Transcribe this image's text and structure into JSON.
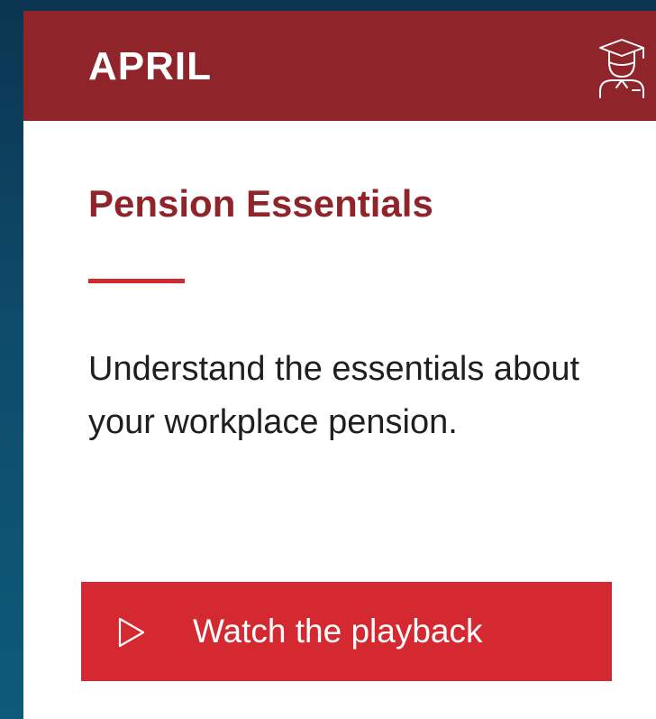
{
  "card": {
    "month": "APRIL",
    "header_icon": "graduation-student-icon",
    "title": "Pension Essentials",
    "description": "Understand the essentials about your workplace pension.",
    "action": {
      "label": "Watch the playback",
      "icon": "play-icon"
    }
  },
  "colors": {
    "header_background": "#8f242b",
    "title_color": "#8f242b",
    "accent_underline": "#cf2a30",
    "button_background": "#d42931",
    "page_background": "#0e4b6a"
  }
}
